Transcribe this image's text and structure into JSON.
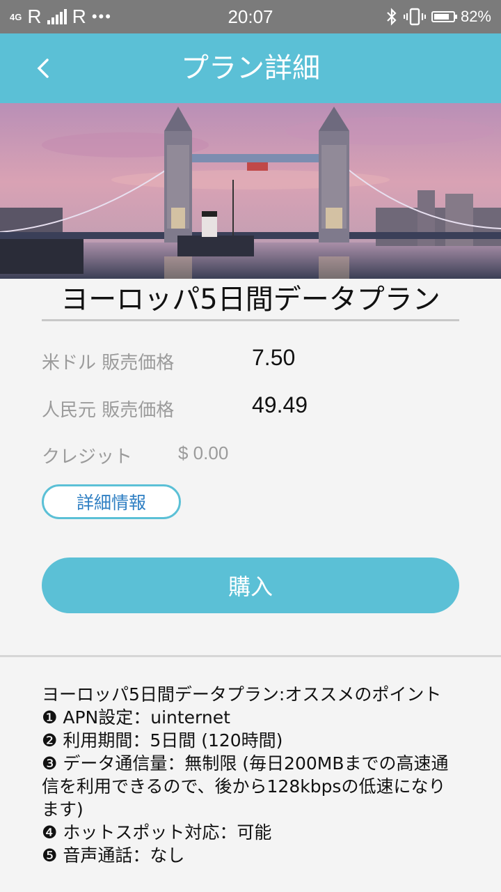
{
  "status_bar": {
    "network": "4G",
    "roaming1": "R",
    "roaming2": "R",
    "dots": "•••",
    "time": "20:07",
    "battery": "82%",
    "icons": [
      "bluetooth-icon",
      "vibrate-icon",
      "battery-icon"
    ]
  },
  "header": {
    "title": "プラン詳細",
    "back_icon": "chevron-left-icon",
    "background": "#5bc0d6"
  },
  "hero": {
    "image": "tower-bridge-sunset"
  },
  "plan": {
    "name": "ヨーロッパ5日間データプラン",
    "usd_label": "米ドル 販売価格",
    "usd_value": "7.50",
    "cny_label": "人民元 販売価格",
    "cny_value": "49.49",
    "credit_label": "クレジット",
    "credit_value": "$ 0.00"
  },
  "buttons": {
    "detail": "詳細情報",
    "buy": "購入"
  },
  "description": {
    "heading": "ヨーロッパ5日間データプラン:オススメのポイント",
    "items": [
      "❶ APN設定：uinternet",
      "❷ 利用期間：5日間 (120時間)",
      "❸ データ通信量：無制限 (毎日200MBまでの高速通信を利用できるので、後から128kbpsの低速になります)",
      "❹ ホットスポット対応：可能",
      "❺ 音声通話：なし"
    ]
  },
  "colors": {
    "accent": "#5bc0d6",
    "link": "#2f7fc3",
    "status_bar": "#7b7b7b"
  }
}
